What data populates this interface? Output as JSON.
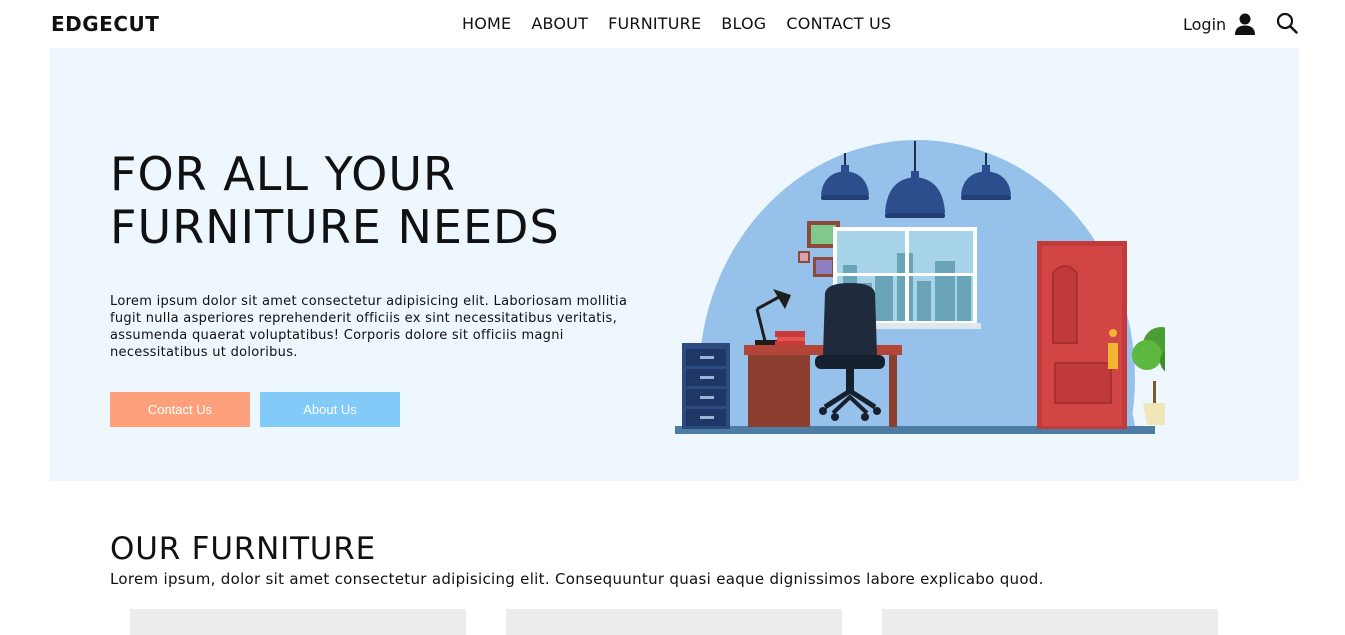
{
  "nav": {
    "brand": "EDGECUT",
    "items": [
      "HOME",
      "ABOUT",
      "FURNITURE",
      "BLOG",
      "CONTACT US"
    ],
    "login_label": "Login",
    "icons": {
      "user": "user-icon",
      "search": "search-icon"
    }
  },
  "hero": {
    "title_line1": "FOR ALL YOUR",
    "title_line2": "FURNITURE NEEDS",
    "text": "Lorem ipsum dolor sit amet consectetur adipisicing elit. Laboriosam mollitia fugit nulla asperiores reprehenderit officiis ex sint necessitatibus veritatis, assumenda quaerat voluptatibus! Corporis dolore sit officiis magni necessitatibus ut doloribus.",
    "contact_button": "Contact Us",
    "about_button": "About Us"
  },
  "furniture_section": {
    "title": "OUR FURNITURE",
    "text": "Lorem ipsum, dolor sit amet consectetur adipisicing elit. Consequuntur quasi eaque dignissimos labore explicabo quod."
  },
  "colors": {
    "hero_bg": "#eef7fe",
    "contact_button": "#fda17d",
    "about_button": "#82cbf8",
    "card_bg": "#edebeb"
  }
}
